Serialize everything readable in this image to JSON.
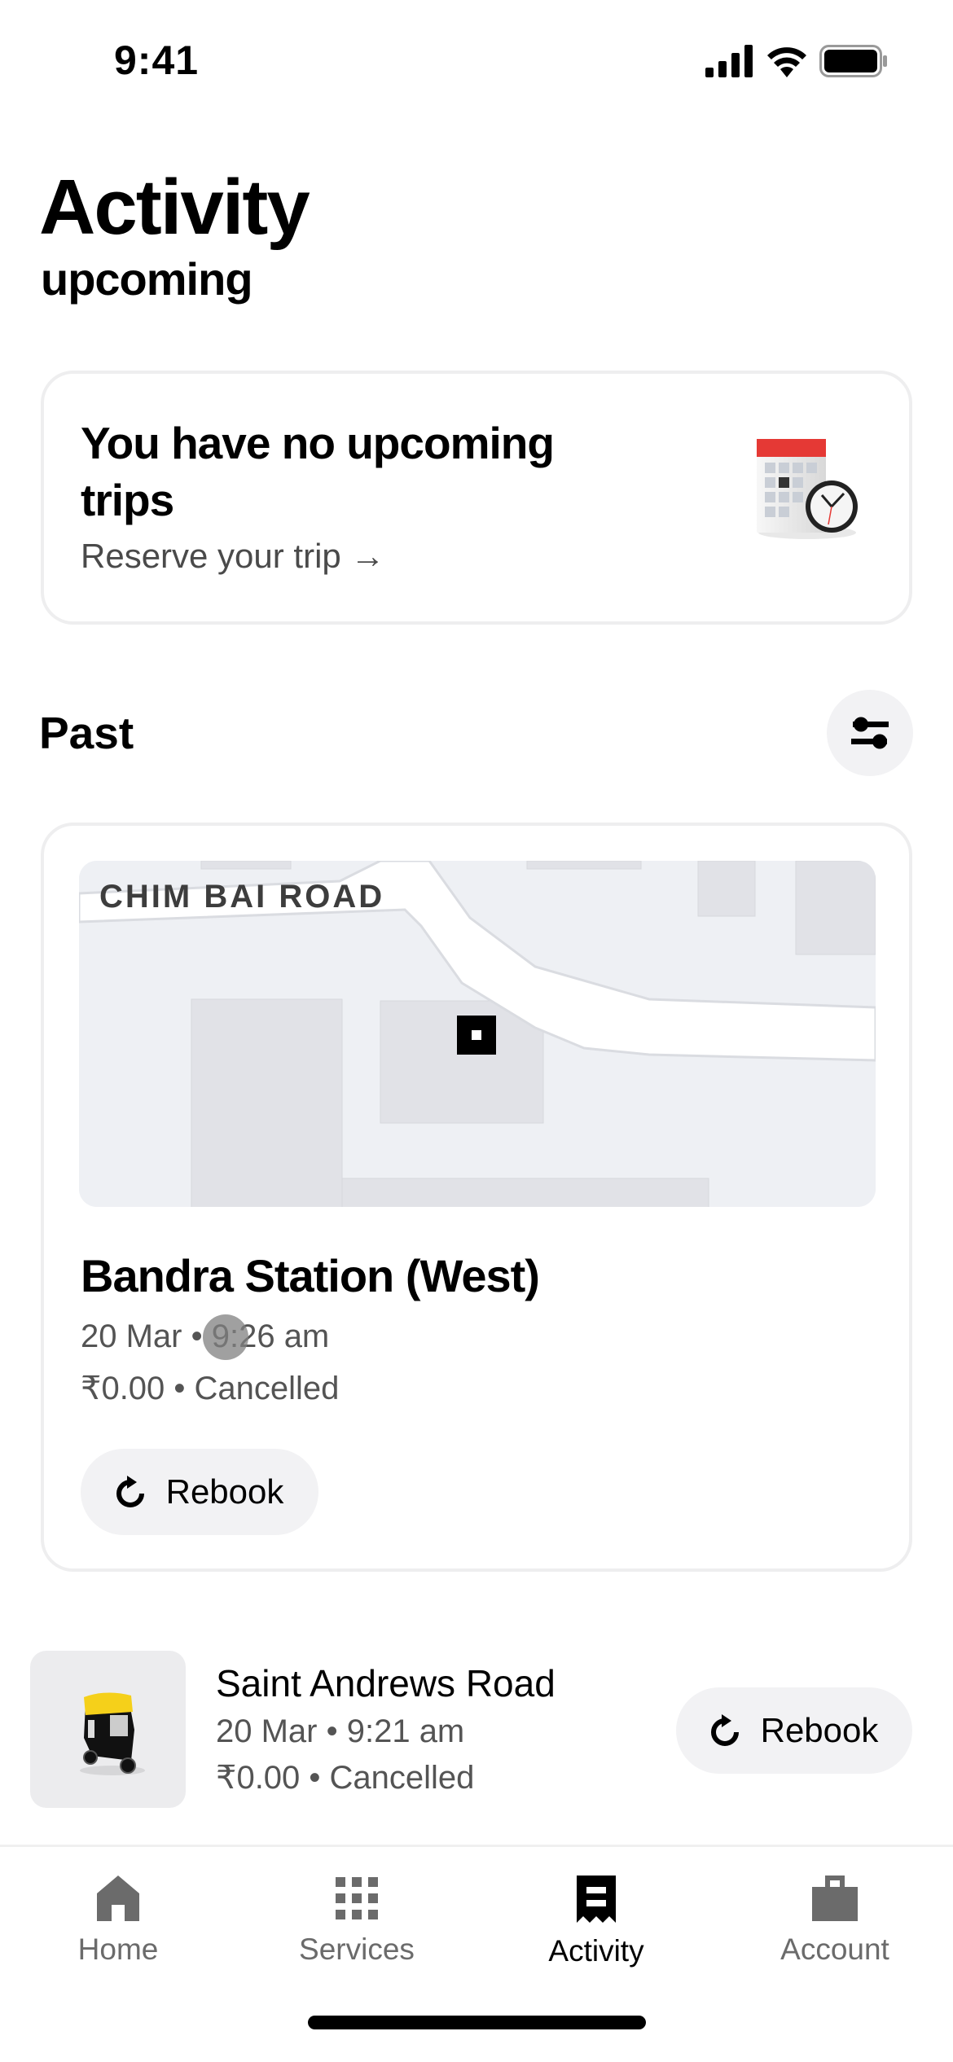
{
  "status_bar": {
    "time": "9:41"
  },
  "header": {
    "title": "Activity",
    "subtitle": "upcoming"
  },
  "upcoming_card": {
    "title": "You have no upcoming trips",
    "link": "Reserve your trip →",
    "image": "calendar-clock-icon"
  },
  "past": {
    "title": "Past",
    "filter_icon": "sliders-icon",
    "featured_trip": {
      "map_label": "CHIM BAI ROAD",
      "destination": "Bandra Station (West)",
      "datetime": "20 Mar • 9:26 am",
      "price_status": "₹0.00 • Cancelled",
      "rebook_label": "Rebook"
    },
    "trips": [
      {
        "destination": "Saint Andrews Road",
        "datetime": "20 Mar • 9:21 am",
        "price_status": "₹0.00 • Cancelled",
        "rebook_label": "Rebook",
        "vehicle": "auto-rickshaw"
      }
    ]
  },
  "tabbar": {
    "items": [
      {
        "label": "Home",
        "icon": "home-icon",
        "active": false
      },
      {
        "label": "Services",
        "icon": "grid-icon",
        "active": false
      },
      {
        "label": "Activity",
        "icon": "receipt-icon",
        "active": true
      },
      {
        "label": "Account",
        "icon": "briefcase-icon",
        "active": false
      }
    ]
  },
  "colors": {
    "accent": "#000000",
    "inactive": "#6b6b6b",
    "surface": "#f2f2f4",
    "calendar_red": "#e53935",
    "auto_yellow": "#f5d01a"
  }
}
